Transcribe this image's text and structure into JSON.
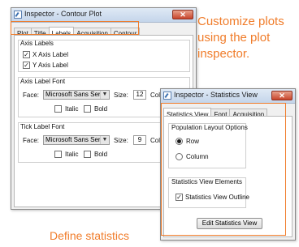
{
  "colors": {
    "accent": "#f07c2a",
    "title_bar": "#c4d5ea",
    "close_button": "#c8452c"
  },
  "contour_window": {
    "title": "Inspector - Contour Plot",
    "close_glyph": "✕",
    "tabs": [
      {
        "label": "Plot"
      },
      {
        "label": "Title"
      },
      {
        "label": "Labels"
      },
      {
        "label": "Acquisition"
      },
      {
        "label": "Contour"
      }
    ],
    "active_tab": "Labels",
    "axis_labels": {
      "heading": "Axis Labels",
      "x_axis_label": "X Axis Label",
      "y_axis_label": "Y Axis Label",
      "x_checked": true,
      "y_checked": true
    },
    "axis_label_font": {
      "heading": "Axis Label Font",
      "face_label": "Face:",
      "face_value": "Microsoft Sans Serif",
      "size_label": "Size:",
      "size_value": "12",
      "color_label": "Color",
      "italic_label": "Italic",
      "bold_label": "Bold"
    },
    "tick_label_font": {
      "heading": "Tick Label Font",
      "face_label": "Face:",
      "face_value": "Microsoft Sans Serif",
      "size_label": "Size:",
      "size_value": "9",
      "color_label": "Color",
      "italic_label": "Italic",
      "bold_label": "Bold"
    }
  },
  "stats_window": {
    "title": "Inspector - Statistics View",
    "close_glyph": "✕",
    "tabs": [
      {
        "label": "Statistics View"
      },
      {
        "label": "Font"
      },
      {
        "label": "Acquisition"
      }
    ],
    "active_tab": "Statistics View",
    "population_layout": {
      "heading": "Population Layout Options",
      "row_label": "Row",
      "column_label": "Column",
      "selected": "Row"
    },
    "elements": {
      "heading": "Statistics View Elements",
      "outline_label": "Statistics View Outline",
      "outline_checked": true
    },
    "edit_button_label": "Edit Statistics View"
  },
  "callouts": {
    "customize": [
      "Customize plots",
      "using the plot",
      "inspector."
    ],
    "define": "Define statistics"
  }
}
